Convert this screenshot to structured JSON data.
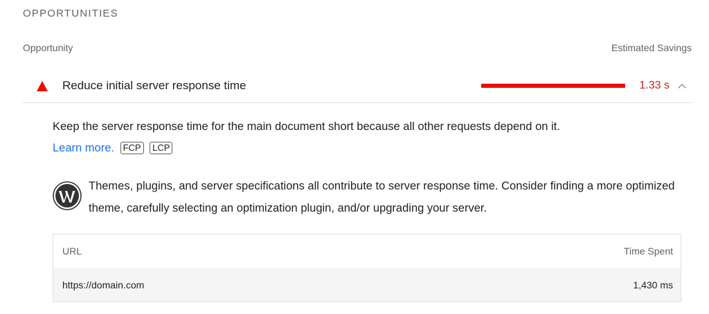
{
  "section": {
    "title": "OPPORTUNITIES"
  },
  "columns": {
    "opportunity": "Opportunity",
    "savings": "Estimated Savings"
  },
  "audit": {
    "title": "Reduce initial server response time",
    "savings_value": "1.33 s",
    "savings_fraction": 1.0,
    "status_color": "#eb0f00",
    "description": "Keep the server response time for the main document short because all other requests depend on it.",
    "learn_more": "Learn more.",
    "badges": [
      "FCP",
      "LCP"
    ],
    "stack_pack": {
      "icon": "wordpress-icon",
      "text": "Themes, plugins, and server specifications all contribute to server response time. Consider finding a more optimized theme, carefully selecting an optimization plugin, and/or upgrading your server."
    },
    "table": {
      "headers": [
        "URL",
        "Time Spent"
      ],
      "rows": [
        {
          "url": "https://domain.com",
          "time": "1,430 ms"
        }
      ]
    }
  },
  "colors": {
    "link": "#1a73e8",
    "fail": "#eb0f00",
    "savings_text": "#c5221f"
  }
}
